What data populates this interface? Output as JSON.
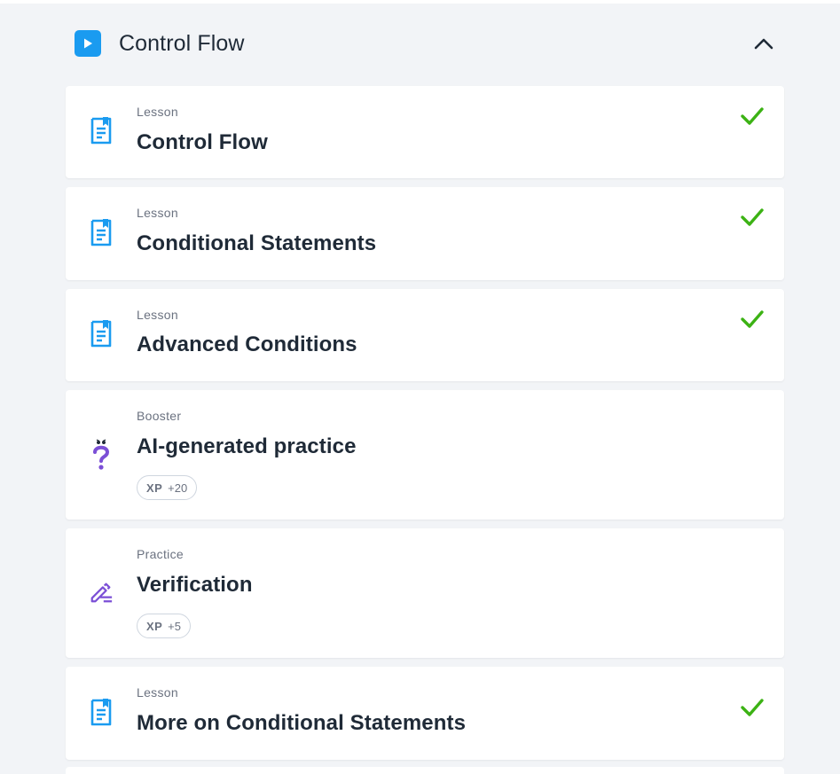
{
  "section": {
    "title": "Control Flow",
    "icon": "play-icon",
    "collapse_icon": "chevron-up-icon"
  },
  "items": [
    {
      "kind": "Lesson",
      "title": "Control Flow",
      "icon": "lesson-document-icon",
      "completed": true
    },
    {
      "kind": "Lesson",
      "title": "Conditional Statements",
      "icon": "lesson-document-icon",
      "completed": true
    },
    {
      "kind": "Lesson",
      "title": "Advanced Conditions",
      "icon": "lesson-document-icon",
      "completed": true
    },
    {
      "kind": "Booster",
      "title": "AI-generated practice",
      "icon": "question-mark-icon",
      "completed": false,
      "xp_label": "XP",
      "xp_value": "+20"
    },
    {
      "kind": "Practice",
      "title": "Verification",
      "icon": "pencil-edit-icon",
      "completed": false,
      "xp_label": "XP",
      "xp_value": "+5"
    },
    {
      "kind": "Lesson",
      "title": "More on Conditional Statements",
      "icon": "lesson-document-icon",
      "completed": true
    }
  ],
  "colors": {
    "accent_blue": "#1a9bf0",
    "check_green": "#3cb214",
    "purple": "#7b4fd6",
    "background": "#f2f4f7"
  }
}
